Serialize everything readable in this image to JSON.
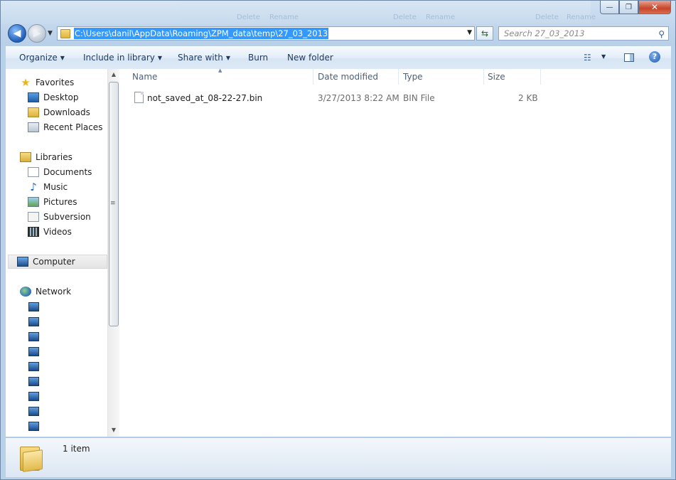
{
  "window": {
    "minimize_glyph": "—",
    "maximize_glyph": "❐",
    "close_glyph": "✕"
  },
  "ghost_strip": {
    "labels": [
      "Delete",
      "Rename",
      "Delete",
      "Rename",
      "Delete",
      "Rename"
    ]
  },
  "navigation": {
    "back_icon": "back-arrow-icon",
    "forward_icon": "forward-arrow-icon",
    "address_path": "C:\\Users\\danil\\AppData\\Roaming\\ZPM_data\\temp\\27_03_2013",
    "search_placeholder": "Search 27_03_2013"
  },
  "toolbar": {
    "organize": "Organize",
    "include_in_library": "Include in library",
    "share_with": "Share with",
    "burn": "Burn",
    "new_folder": "New folder"
  },
  "nav_pane": {
    "favorites": {
      "label": "Favorites",
      "items": [
        "Desktop",
        "Downloads",
        "Recent Places"
      ]
    },
    "libraries": {
      "label": "Libraries",
      "items": [
        "Documents",
        "Music",
        "Pictures",
        "Subversion",
        "Videos"
      ]
    },
    "computer": "Computer",
    "network": "Network"
  },
  "file_list": {
    "columns": [
      "Name",
      "Date modified",
      "Type",
      "Size"
    ],
    "rows": [
      {
        "name": "not_saved_at_08-22-27.bin",
        "date_modified": "3/27/2013 8:22 AM",
        "type": "BIN File",
        "size": "2 KB"
      }
    ]
  },
  "details_pane": {
    "item_count": "1 item"
  },
  "colors": {
    "selection": "#3399ff",
    "frame": "#b9d0e9",
    "header_text": "#4c607a"
  }
}
